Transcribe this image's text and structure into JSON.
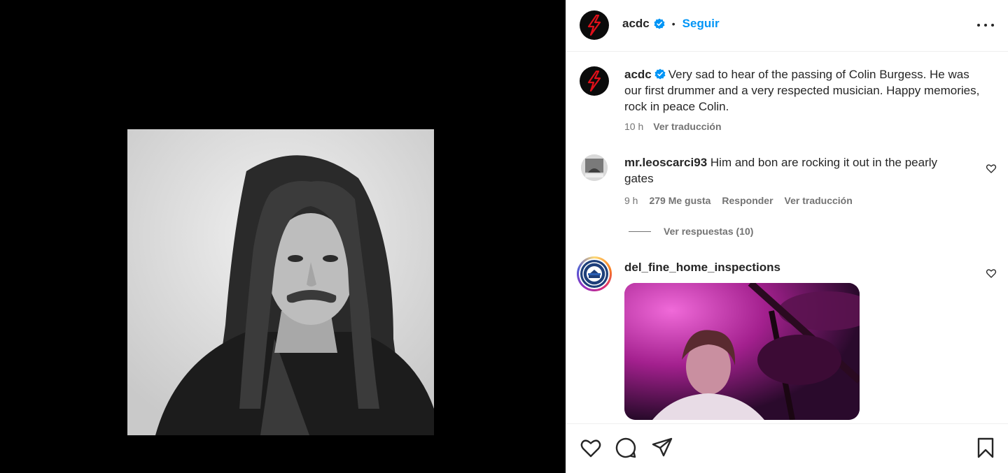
{
  "post": {
    "author": "acdc",
    "follow_label": "Seguir",
    "caption_author": "acdc",
    "caption": "Very sad to hear of the passing of Colin Burgess. He was our first drummer and a very respected musician. Happy memories, rock in peace Colin.",
    "caption_time": "10 h",
    "caption_translate": "Ver traducción"
  },
  "comments": [
    {
      "username": "mr.leoscarci93",
      "text": "Him and bon are rocking it out in the pearly gates",
      "time": "9 h",
      "likes": "279 Me gusta",
      "reply_label": "Responder",
      "translate_label": "Ver traducción",
      "view_replies": "Ver respuestas (10)"
    },
    {
      "username": "del_fine_home_inspections"
    }
  ],
  "colors": {
    "follow": "#0095f6",
    "text": "#262626",
    "muted": "#737373",
    "logo_red": "#e0101a"
  },
  "icons": [
    "acdc-bolt-logo",
    "verified-badge-icon",
    "more-options-icon",
    "heart-icon",
    "comment-icon",
    "share-icon",
    "bookmark-icon"
  ]
}
